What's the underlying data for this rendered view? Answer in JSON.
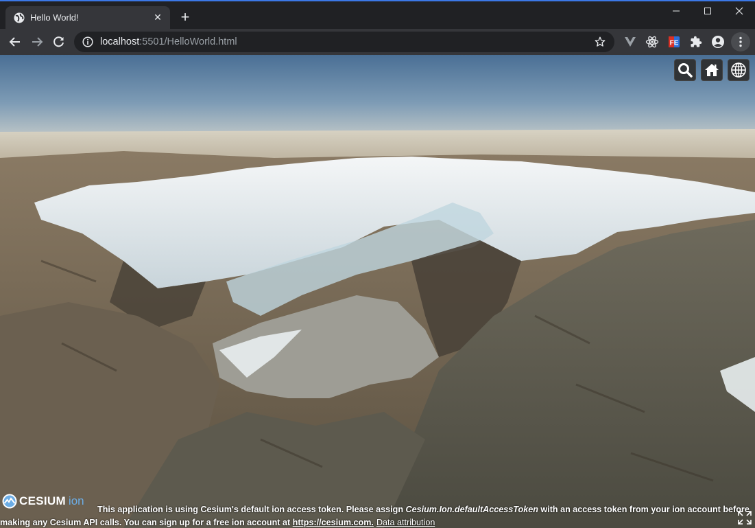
{
  "browser": {
    "tab": {
      "title": "Hello World!",
      "close_glyph": "✕",
      "favicon": "globe-icon"
    },
    "new_tab_glyph": "+",
    "address": {
      "host": "localhost",
      "path": ":5501/HelloWorld.html"
    },
    "extensions": [
      "vue-devtools-icon",
      "react-devtools-icon",
      "fe-helper-icon",
      "puzzle-icon",
      "profile-icon"
    ],
    "colors": {
      "tabstrip": "#202124",
      "toolbar": "#35363a",
      "accent": "#3b78e7"
    }
  },
  "cesium": {
    "toolbar_buttons": [
      "search-icon",
      "home-icon",
      "globe-icon"
    ],
    "logo": {
      "wordmark": "CESIUM",
      "ion": "ion"
    },
    "credit": {
      "line1_prefix": "This application is using Cesium's default ion access token. Please assign ",
      "line1_code": "Cesium.Ion.defaultAccessToken",
      "line1_suffix": " with an access token from your ion account before",
      "line2_prefix": "making any Cesium API calls. You can sign up for a free ion account at ",
      "line2_link": "https://cesium.com.",
      "attribution": "Data attribution"
    }
  }
}
